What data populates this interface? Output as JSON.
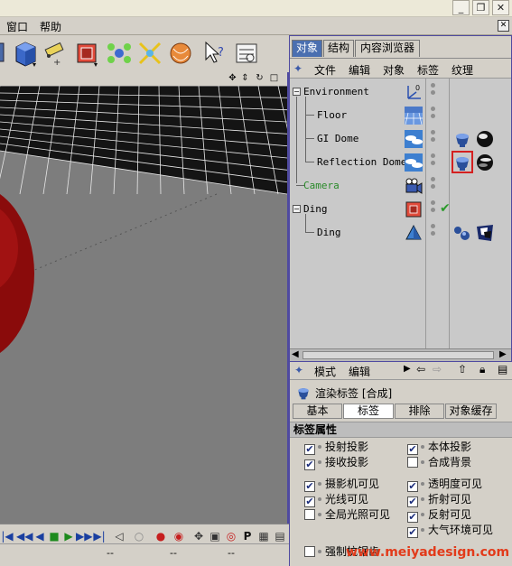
{
  "menubar": {
    "items": [
      "窗口",
      "帮助"
    ]
  },
  "window_controls": {
    "minimize": "_",
    "restore": "❐",
    "close": "✕"
  },
  "viewport_nav": [
    "✥",
    "⇕",
    "↻",
    "□"
  ],
  "object_manager": {
    "tabs": [
      "对象",
      "结构",
      "内容浏览器"
    ],
    "active_tab": "对象",
    "menu": [
      "文件",
      "编辑",
      "对象",
      "标签",
      "纹理"
    ],
    "objects": [
      {
        "name": "Environment",
        "depth": 0,
        "expander": "−"
      },
      {
        "name": "Floor",
        "depth": 1
      },
      {
        "name": "GI Dome",
        "depth": 1
      },
      {
        "name": "Reflection Dome",
        "depth": 1
      },
      {
        "name": "Camera",
        "depth": 0,
        "color": "#2a8a2a"
      },
      {
        "name": "Ding",
        "depth": 0,
        "expander": "−",
        "check": "✔"
      },
      {
        "name": "Ding",
        "depth": 1
      }
    ]
  },
  "attributes": {
    "menu": [
      "模式",
      "编辑"
    ],
    "title": "渲染标签 [合成]",
    "tabs": [
      "基本",
      "标签",
      "排除",
      "对象缓存"
    ],
    "active_tab": "标签",
    "section": "标签属性",
    "options_left": [
      {
        "label": "投射投影",
        "checked": true
      },
      {
        "label": "接收投影",
        "checked": true
      },
      {
        "label": "摄影机可见",
        "checked": true
      },
      {
        "label": "光线可见",
        "checked": true
      },
      {
        "label": "全局光照可见",
        "checked": false
      },
      {
        "label": "强制抗锯齿",
        "checked": false
      }
    ],
    "options_right": [
      {
        "label": "本体投影",
        "checked": true
      },
      {
        "label": "合成背景",
        "checked": false
      },
      {
        "label": "透明度可见",
        "checked": true
      },
      {
        "label": "折射可见",
        "checked": true
      },
      {
        "label": "反射可见",
        "checked": true
      },
      {
        "label": "大气环境可见",
        "checked": true
      }
    ]
  },
  "timeline": {
    "buttons": [
      "|◀",
      "◀◀",
      "◀",
      "■",
      "▶",
      "▶▶",
      "▶|"
    ],
    "coords": [
      "--",
      "--",
      "--"
    ]
  },
  "watermark": "www.meiyadesign.com",
  "colors": {
    "accent": "#4a6fb0",
    "panel_border": "#4f4aa0",
    "viewport_bg": "#7d7d7d",
    "grid": "#ffffff",
    "sphere": "#8a0b0b",
    "watermark": "#e23a1a",
    "highlight_box": "#d42020"
  }
}
